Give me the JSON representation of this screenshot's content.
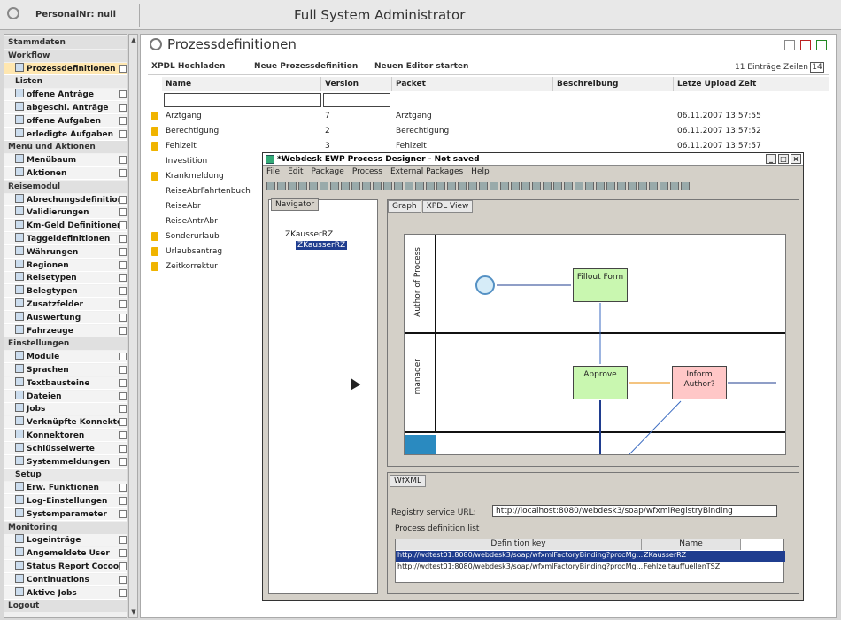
{
  "header": {
    "personal_nr": "PersonalNr: null",
    "title": "Full System Administrator"
  },
  "sidebar": {
    "items": [
      {
        "label": "Stammdaten",
        "kind": "sec"
      },
      {
        "label": "Workflow",
        "kind": "sec"
      },
      {
        "label": "Prozessdefinitionen",
        "kind": "it",
        "active": true
      },
      {
        "label": "Listen",
        "kind": "sub"
      },
      {
        "label": "offene Anträge",
        "kind": "it"
      },
      {
        "label": "abgeschl. Anträge",
        "kind": "it"
      },
      {
        "label": "offene Aufgaben",
        "kind": "it"
      },
      {
        "label": "erledigte Aufgaben",
        "kind": "it"
      },
      {
        "label": "Menü und Aktionen",
        "kind": "sec"
      },
      {
        "label": "Menübaum",
        "kind": "it"
      },
      {
        "label": "Aktionen",
        "kind": "it"
      },
      {
        "label": "Reisemodul",
        "kind": "sec"
      },
      {
        "label": "Abrechungsdefinitionen",
        "kind": "it"
      },
      {
        "label": "Validierungen",
        "kind": "it"
      },
      {
        "label": "Km-Geld Definitionen",
        "kind": "it"
      },
      {
        "label": "Taggeldefinitionen",
        "kind": "it"
      },
      {
        "label": "Währungen",
        "kind": "it"
      },
      {
        "label": "Regionen",
        "kind": "it"
      },
      {
        "label": "Reisetypen",
        "kind": "it"
      },
      {
        "label": "Belegtypen",
        "kind": "it"
      },
      {
        "label": "Zusatzfelder",
        "kind": "it"
      },
      {
        "label": "Auswertung",
        "kind": "it"
      },
      {
        "label": "Fahrzeuge",
        "kind": "it"
      },
      {
        "label": "Einstellungen",
        "kind": "sec"
      },
      {
        "label": "Module",
        "kind": "it"
      },
      {
        "label": "Sprachen",
        "kind": "it"
      },
      {
        "label": "Textbausteine",
        "kind": "it"
      },
      {
        "label": "Dateien",
        "kind": "it"
      },
      {
        "label": "Jobs",
        "kind": "it"
      },
      {
        "label": "Verknüpfte Konnektoren",
        "kind": "it"
      },
      {
        "label": "Konnektoren",
        "kind": "it"
      },
      {
        "label": "Schlüsselwerte",
        "kind": "it"
      },
      {
        "label": "Systemmeldungen",
        "kind": "it"
      },
      {
        "label": "Setup",
        "kind": "sub"
      },
      {
        "label": "Erw. Funktionen",
        "kind": "it"
      },
      {
        "label": "Log-Einstellungen",
        "kind": "it"
      },
      {
        "label": "Systemparameter",
        "kind": "it"
      },
      {
        "label": "Monitoring",
        "kind": "sec"
      },
      {
        "label": "Logeinträge",
        "kind": "it"
      },
      {
        "label": "Angemeldete User",
        "kind": "it"
      },
      {
        "label": "Status Report Cocoon",
        "kind": "it"
      },
      {
        "label": "Continuations",
        "kind": "it"
      },
      {
        "label": "Aktive Jobs",
        "kind": "it"
      },
      {
        "label": "Logout",
        "kind": "sec"
      }
    ]
  },
  "page": {
    "title": "Prozessdefinitionen"
  },
  "toolbar": {
    "xpdl": "XPDL Hochladen",
    "new_def": "Neue Prozessdefinition",
    "new_editor": "Neuen Editor starten",
    "count": "11 Einträge",
    "rows_label": "Zeilen",
    "rows_value": "14"
  },
  "table": {
    "headers": [
      "Name",
      "Version",
      "Packet",
      "Beschreibung",
      "Letze Upload Zeit"
    ],
    "rows": [
      {
        "name": "Arztgang",
        "version": "7",
        "packet": "Arztgang",
        "desc": "",
        "time": "06.11.2007 13:57:55",
        "pen": true
      },
      {
        "name": "Berechtigung",
        "version": "2",
        "packet": "Berechtigung",
        "desc": "",
        "time": "06.11.2007 13:57:52",
        "pen": true
      },
      {
        "name": "Fehlzeit",
        "version": "3",
        "packet": "Fehlzeit",
        "desc": "",
        "time": "06.11.2007 13:57:57",
        "pen": true
      },
      {
        "name": "Investition",
        "version": "",
        "packet": "",
        "desc": "",
        "time": "",
        "pen": false
      },
      {
        "name": "Krankmeldung",
        "version": "",
        "packet": "",
        "desc": "",
        "time": "",
        "pen": true
      },
      {
        "name": "ReiseAbrFahrtenbuch",
        "version": "",
        "packet": "",
        "desc": "",
        "time": "",
        "pen": false
      },
      {
        "name": "ReiseAbr",
        "version": "",
        "packet": "",
        "desc": "",
        "time": "",
        "pen": false
      },
      {
        "name": "ReiseAntrAbr",
        "version": "",
        "packet": "",
        "desc": "",
        "time": "",
        "pen": false
      },
      {
        "name": "Sonderurlaub",
        "version": "",
        "packet": "",
        "desc": "",
        "time": "",
        "pen": true
      },
      {
        "name": "Urlaubsantrag",
        "version": "",
        "packet": "",
        "desc": "",
        "time": "",
        "pen": true
      },
      {
        "name": "Zeitkorrektur",
        "version": "",
        "packet": "",
        "desc": "",
        "time": "",
        "pen": true
      }
    ]
  },
  "designer": {
    "title": "*Webdesk EWP Process Designer - Not saved",
    "menu": [
      "File",
      "Edit",
      "Package",
      "Process",
      "External Packages",
      "Help"
    ],
    "navigator_tab": "Navigator",
    "tree_root": "ZKausserRZ",
    "tree_child": "ZKausserRZ",
    "tabs": [
      "Graph",
      "XPDL View"
    ],
    "lanes": [
      "Author of Process",
      "manager"
    ],
    "nodes": {
      "fillout": "Fillout Form",
      "approve": "Approve",
      "inform": "Inform Author?"
    },
    "wfxml_tab": "WfXML",
    "registry_label": "Registry service URL:",
    "registry_url": "http://localhost:8080/webdesk3/soap/wfxmlRegistryBinding",
    "pdl_label": "Process definition list",
    "list_headers": [
      "Definition key",
      "Name"
    ],
    "list_rows": [
      {
        "key": "http://wdtest01:8080/webdesk3/soap/wfxmlFactoryBinding?procMg...",
        "name": "ZKausserRZ"
      },
      {
        "key": "http://wdtest01:8080/webdesk3/soap/wfxmlFactoryBinding?procMg...",
        "name": "FehlzeitauffuellenTSZ"
      }
    ]
  },
  "colors": {
    "accent": "#1f3d8f",
    "green_node": "#c9f7b0",
    "red_node": "#ffc7c7",
    "start": "#d6ecf8"
  }
}
